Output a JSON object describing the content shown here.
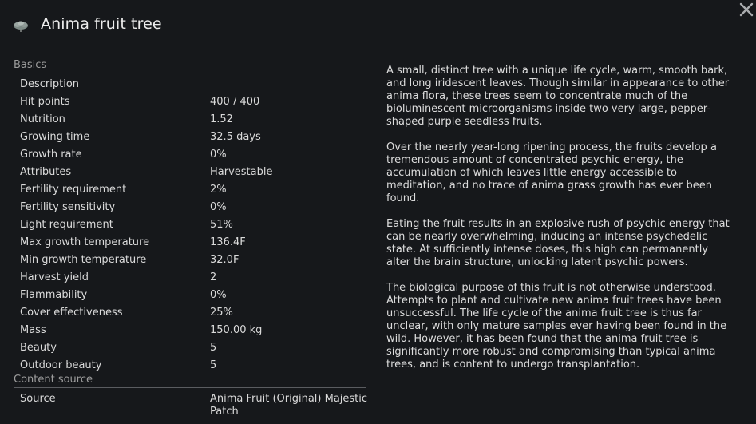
{
  "window": {
    "title": "Anima fruit tree",
    "icon": "tree-icon",
    "close_icon": "close-icon"
  },
  "sections": {
    "basics": {
      "label": "Basics",
      "rows": [
        {
          "label": "Description",
          "value": ""
        },
        {
          "label": "Hit points",
          "value": "400 / 400"
        },
        {
          "label": "Nutrition",
          "value": "1.52"
        },
        {
          "label": "Growing time",
          "value": "32.5 days"
        },
        {
          "label": "Growth rate",
          "value": "0%"
        },
        {
          "label": "Attributes",
          "value": "Harvestable"
        },
        {
          "label": "Fertility requirement",
          "value": "2%"
        },
        {
          "label": "Fertility sensitivity",
          "value": "0%"
        },
        {
          "label": "Light requirement",
          "value": "51%"
        },
        {
          "label": "Max growth temperature",
          "value": "136.4F"
        },
        {
          "label": "Min growth temperature",
          "value": "32.0F"
        },
        {
          "label": "Harvest yield",
          "value": "2"
        },
        {
          "label": "Flammability",
          "value": "0%"
        },
        {
          "label": "Cover effectiveness",
          "value": "25%"
        },
        {
          "label": "Mass",
          "value": "150.00 kg"
        },
        {
          "label": "Beauty",
          "value": "5"
        },
        {
          "label": "Outdoor beauty",
          "value": "5"
        }
      ]
    },
    "content_source": {
      "label": "Content source",
      "rows": [
        {
          "label": "Source",
          "value": "Anima Fruit (Original) Majestic Patch"
        }
      ]
    }
  },
  "description": {
    "paragraphs": [
      "A small, distinct tree with a unique life cycle, warm, smooth bark, and long iridescent leaves. Though similar in appearance to other anima flora, these trees seem to concentrate much of the bioluminescent microorganisms inside two very large, pepper-shaped purple seedless fruits.",
      "Over the nearly year-long ripening process, the fruits develop a tremendous amount of concentrated psychic energy, the accumulation of which leaves little energy accessible to meditation, and no trace of anima grass growth has ever been found.",
      "Eating the fruit results in an explosive rush of psychic energy that can be nearly overwhelming, inducing an intense psychedelic state. At sufficiently intense doses, this high can permanently alter the brain structure, unlocking latent psychic powers.",
      "The biological purpose of this fruit is not otherwise understood. Attempts to plant and cultivate new anima fruit trees have been unsuccessful. The life cycle of the anima fruit tree is thus far unclear, with only mature samples ever having been found in the wild. However, it has been found that the anima fruit tree is significantly more robust and compromising than typical anima trees, and is content to undergo transplantation."
    ]
  }
}
